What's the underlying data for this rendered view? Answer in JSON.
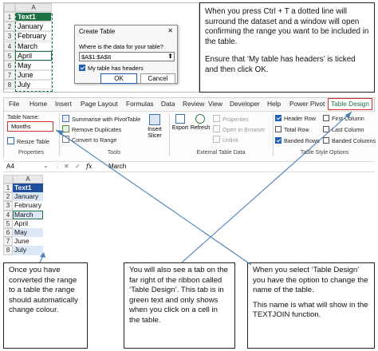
{
  "top_sheet": {
    "col_header": "A",
    "rows": [
      {
        "num": "1",
        "value": "Text1"
      },
      {
        "num": "2",
        "value": "January"
      },
      {
        "num": "3",
        "value": "February"
      },
      {
        "num": "4",
        "value": "March"
      },
      {
        "num": "5",
        "value": "April"
      },
      {
        "num": "6",
        "value": "May"
      },
      {
        "num": "7",
        "value": "June"
      },
      {
        "num": "8",
        "value": "July"
      }
    ]
  },
  "dialog": {
    "title": "Create Table",
    "question": "Where is the data for your table?",
    "range_value": "$A$1:$A$8",
    "checkbox_label": "My table has headers",
    "ok_label": "OK",
    "cancel_label": "Cancel"
  },
  "callout_top": {
    "p1": "When you press Ctrl + T a dotted line will surround the dataset and a window will open confirming the range you want to be included in the table.",
    "p2": "Ensure that ‘My table has headers’ is ticked and then click OK."
  },
  "ribbon": {
    "tabs": [
      "File",
      "Home",
      "Insert",
      "Page Layout",
      "Formulas",
      "Data",
      "Review",
      "View",
      "Developer",
      "Help",
      "Power Pivot",
      "Table Design"
    ],
    "active_tab": "Table Design",
    "accent": "#1e7145",
    "highlight": "#d32f2f",
    "properties": {
      "table_name_label": "Table Name:",
      "table_name_value": "Months",
      "resize_label": "Resize Table",
      "group_label": "Properties"
    },
    "tools": {
      "summarise": "Summarise with PivotTable",
      "remove_duplicates": "Remove Duplicates",
      "convert": "Convert to Range",
      "insert_slicer": "Insert Slicer",
      "group_label": "Tools"
    },
    "external": {
      "export": "Export",
      "refresh": "Refresh",
      "properties": "Properties",
      "open_browser": "Open in Browser",
      "unlink": "Unlink",
      "group_label": "External Table Data"
    },
    "style_options": {
      "header_row": "Header Row",
      "total_row": "Total Row",
      "banded_rows": "Banded Rows",
      "first_column": "First Column",
      "last_column": "Last Column",
      "banded_columns": "Banded Columns",
      "group_label": "Table Style Options"
    }
  },
  "formula_bar": {
    "name_box": "A4",
    "fx": "fx",
    "content": "March"
  },
  "bottom_sheet": {
    "col_header": "A",
    "rows": [
      {
        "num": "1",
        "value": "Text1"
      },
      {
        "num": "2",
        "value": "January"
      },
      {
        "num": "3",
        "value": "February"
      },
      {
        "num": "4",
        "value": "March"
      },
      {
        "num": "5",
        "value": "April"
      },
      {
        "num": "6",
        "value": "May"
      },
      {
        "num": "7",
        "value": "June"
      },
      {
        "num": "8",
        "value": "July"
      }
    ]
  },
  "callouts_bottom": {
    "left": "Once you have converted the range to a table the range should automatically change colour.",
    "middle": "You will also see a tab on the far right of the ribbon called ‘Table Design’. This tab is in green text and only shows when you click on a cell in the table.",
    "right_p1": "When you select ‘Table Design’ you have the option to change the name of the table.",
    "right_p2": "This name is what will show in the TEXTJOIN function."
  }
}
